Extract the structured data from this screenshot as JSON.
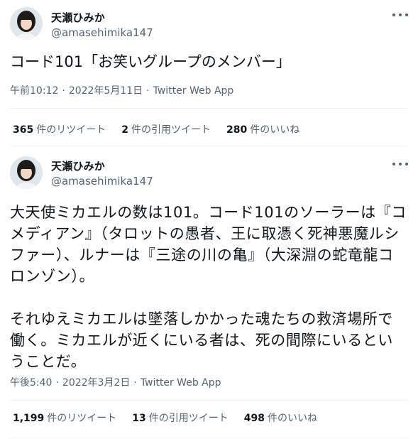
{
  "tweets": [
    {
      "user": {
        "name": "天瀬ひみか",
        "handle": "@amasehimika147"
      },
      "text": "コード101「お笑いグループのメンバー」",
      "time": "午前10:12",
      "date": "2022年5月11日",
      "source": "Twitter Web App",
      "stats": {
        "retweets": {
          "count": "365",
          "label": "件のリツイート"
        },
        "quotes": {
          "count": "2",
          "label": "件の引用ツイート"
        },
        "likes": {
          "count": "280",
          "label": "件のいいね"
        }
      }
    },
    {
      "user": {
        "name": "天瀬ひみか",
        "handle": "@amasehimika147"
      },
      "text": "大天使ミカエルの数は101。コード101のソーラーは『コメディアン』（タロットの愚者、王に取憑く死神悪魔ルシファー）、ルナーは『三途の川の亀』（大深淵の蛇竜龍コロンゾン）。\n\nそれゆえミカエルは墜落しかかった魂たちの救済場所で働く。ミカエルが近くにいる者は、死の間際にいるということだ。",
      "time": "午後5:40",
      "date": "2022年3月2日",
      "source": "Twitter Web App",
      "stats": {
        "retweets": {
          "count": "1,199",
          "label": "件のリツイート"
        },
        "quotes": {
          "count": "13",
          "label": "件の引用ツイート"
        },
        "likes": {
          "count": "498",
          "label": "件のいいね"
        }
      }
    }
  ],
  "separator": "·",
  "icons": {
    "avatar": "avatar-photo",
    "more": "more-icon"
  },
  "colors": {
    "text": "#0f1419",
    "secondary": "#536471",
    "divider": "#eff3f4"
  }
}
